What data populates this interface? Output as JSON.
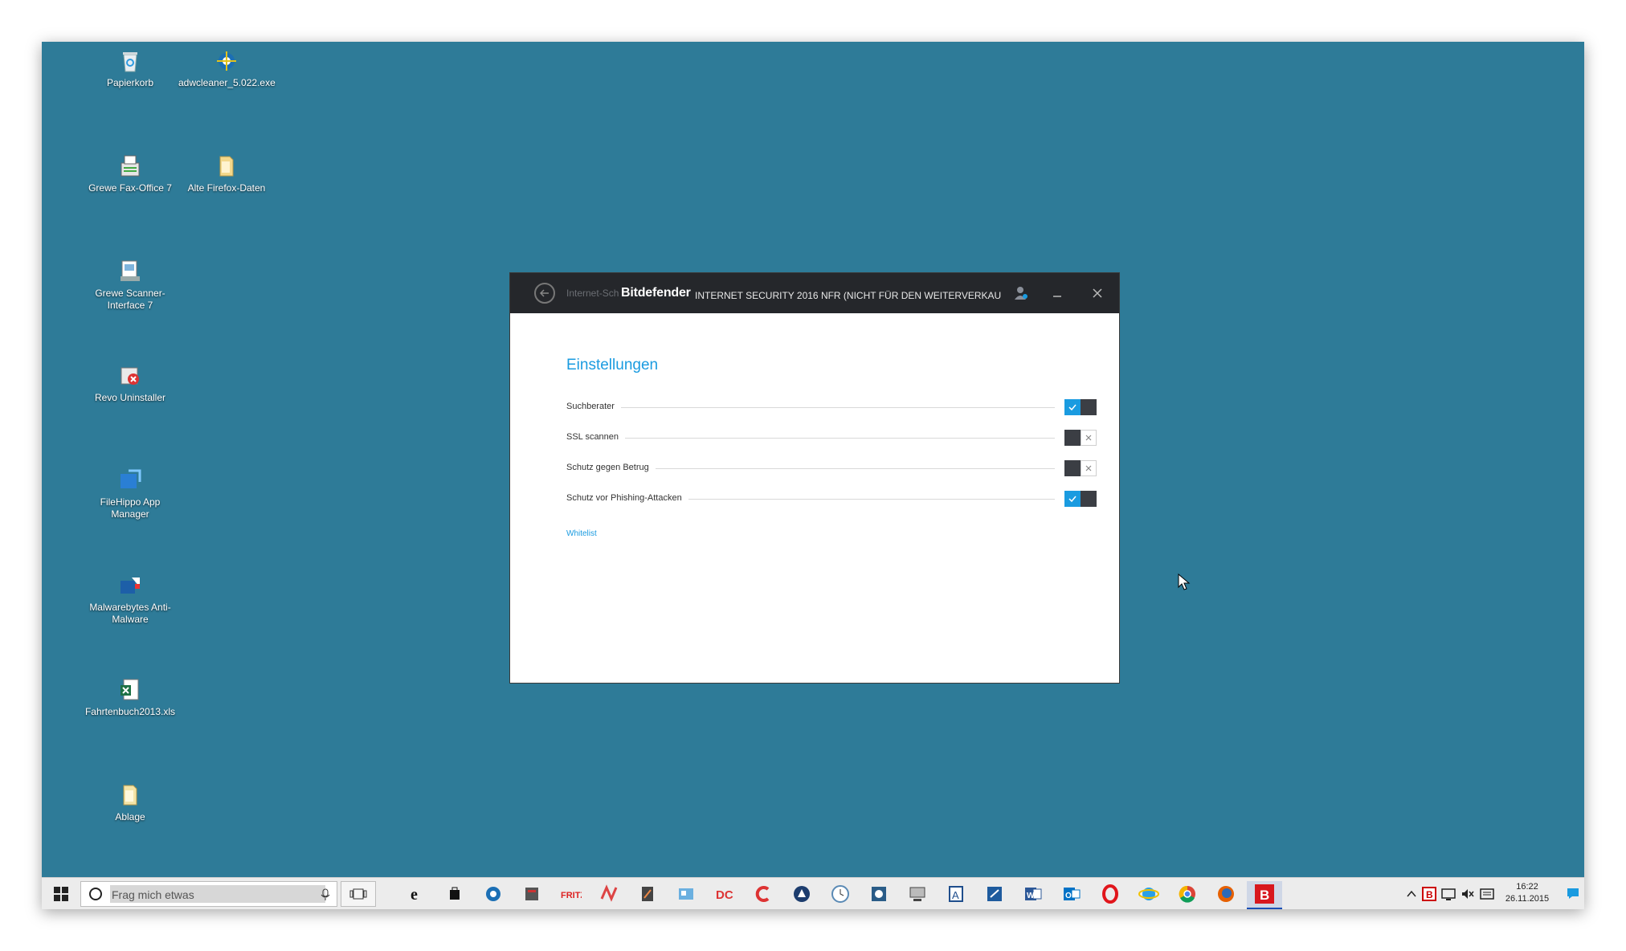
{
  "desktop": {
    "icons": [
      {
        "label": "Papierkorb",
        "icon": "recycle-bin-icon"
      },
      {
        "label": "adwcleaner_5.022.exe",
        "icon": "adwcleaner-icon"
      },
      {
        "label": "Grewe Fax-Office 7",
        "icon": "fax-office-icon"
      },
      {
        "label": "Alte Firefox-Daten",
        "icon": "folder-icon"
      },
      {
        "label": "Grewe Scanner-Interface 7",
        "icon": "scanner-icon"
      },
      {
        "label": "Revo Uninstaller",
        "icon": "revo-uninstaller-icon"
      },
      {
        "label": "FileHippo App Manager",
        "icon": "filehippo-icon"
      },
      {
        "label": "Malwarebytes Anti-Malware",
        "icon": "malwarebytes-icon"
      },
      {
        "label": "Fahrtenbuch2013.xls",
        "icon": "excel-file-icon"
      },
      {
        "label": "Ablage",
        "icon": "folder-icon"
      }
    ]
  },
  "window": {
    "breadcrumb": "Internet-Sch",
    "brand": "Bitdefender",
    "product": "INTERNET SECURITY 2016 NFR (NICHT FÜR DEN WEITERVERKAU",
    "heading": "Einstellungen",
    "settings": [
      {
        "label": "Suchberater",
        "enabled": true
      },
      {
        "label": "SSL scannen",
        "enabled": false
      },
      {
        "label": "Schutz gegen Betrug",
        "enabled": false
      },
      {
        "label": "Schutz vor Phishing-Attacken",
        "enabled": true
      }
    ],
    "whitelist_link": "Whitelist",
    "accent": "#1a9be0",
    "titlebar_color": "#25272b"
  },
  "taskbar": {
    "search_placeholder": "Frag mich etwas",
    "apps": [
      "edge-icon",
      "store-icon",
      "settings-icon",
      "toolbox-icon",
      "fritz-icon",
      "paint-icon",
      "editor-icon",
      "control-panel-icon",
      "dc-icon",
      "ccleaner-icon",
      "app-icon",
      "clock-app-icon",
      "camera-icon",
      "monitor-icon",
      "word-a-icon",
      "network-icon",
      "word-icon",
      "outlook-icon",
      "opera-icon",
      "ie-icon",
      "chrome-icon",
      "firefox-icon",
      "bitdefender-icon"
    ],
    "clock_time": "16:22",
    "clock_date": "26.11.2015"
  },
  "colors": {
    "desktop_bg": "#2e7b98"
  }
}
